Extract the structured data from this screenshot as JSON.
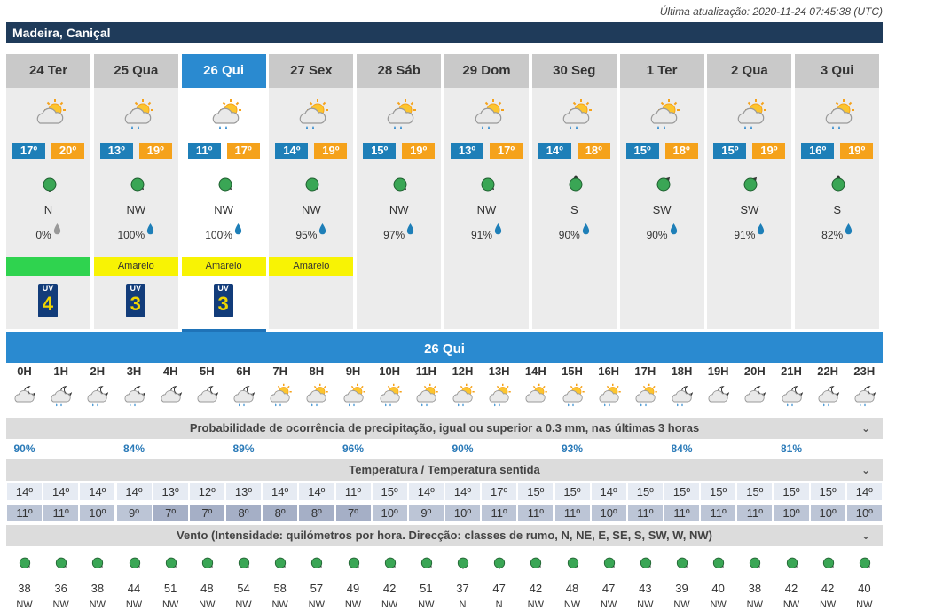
{
  "last_update": "Última atualização: 2020-11-24 07:45:38 (UTC)",
  "location": "Madeira, Caniçal",
  "colors": {
    "location_bar": "#1f3b5a",
    "selected_day": "#2a8ad0",
    "tmin": "#1e7fb8",
    "tmax": "#f5a21b",
    "warn_green": "#2fd34f",
    "warn_yellow": "#f8f304"
  },
  "days": [
    {
      "label": "24 Ter",
      "icon": "sun-cloud-icon",
      "tmin": "17º",
      "tmax": "20º",
      "wind_dir": "N",
      "precip": "0%",
      "drop": "grey",
      "warning": "",
      "warning_color": "green",
      "uv": "4"
    },
    {
      "label": "25 Qua",
      "icon": "sun-cloud-rain-icon",
      "tmin": "13º",
      "tmax": "19º",
      "wind_dir": "NW",
      "precip": "100%",
      "drop": "blue",
      "warning": "Amarelo",
      "warning_color": "yellow",
      "uv": "3"
    },
    {
      "label": "26 Qui",
      "icon": "sun-cloud-rain-icon",
      "tmin": "11º",
      "tmax": "17º",
      "wind_dir": "NW",
      "precip": "100%",
      "drop": "blue",
      "warning": "Amarelo",
      "warning_color": "yellow",
      "uv": "3",
      "selected": true
    },
    {
      "label": "27 Sex",
      "icon": "sun-cloud-rain-icon",
      "tmin": "14º",
      "tmax": "19º",
      "wind_dir": "NW",
      "precip": "95%",
      "drop": "blue",
      "warning": "Amarelo",
      "warning_color": "yellow",
      "uv": ""
    },
    {
      "label": "28 Sáb",
      "icon": "sun-cloud-rain-icon",
      "tmin": "15º",
      "tmax": "19º",
      "wind_dir": "NW",
      "precip": "97%",
      "drop": "blue",
      "warning": "",
      "warning_color": "",
      "uv": ""
    },
    {
      "label": "29 Dom",
      "icon": "sun-cloud-rain-icon",
      "tmin": "13º",
      "tmax": "17º",
      "wind_dir": "NW",
      "precip": "91%",
      "drop": "blue",
      "warning": "",
      "warning_color": "",
      "uv": ""
    },
    {
      "label": "30 Seg",
      "icon": "sun-cloud-rain-icon",
      "tmin": "14º",
      "tmax": "18º",
      "wind_dir": "S",
      "precip": "90%",
      "drop": "blue",
      "warning": "",
      "warning_color": "",
      "uv": ""
    },
    {
      "label": "1 Ter",
      "icon": "sun-cloud-rain-icon",
      "tmin": "15º",
      "tmax": "18º",
      "wind_dir": "SW",
      "precip": "90%",
      "drop": "blue",
      "warning": "",
      "warning_color": "",
      "uv": ""
    },
    {
      "label": "2 Qua",
      "icon": "sun-cloud-rain-icon",
      "tmin": "15º",
      "tmax": "19º",
      "wind_dir": "SW",
      "precip": "91%",
      "drop": "blue",
      "warning": "",
      "warning_color": "",
      "uv": ""
    },
    {
      "label": "3 Qui",
      "icon": "sun-cloud-rain-icon",
      "tmin": "16º",
      "tmax": "19º",
      "wind_dir": "S",
      "precip": "82%",
      "drop": "blue",
      "warning": "",
      "warning_color": "",
      "uv": ""
    }
  ],
  "selected_day_title": "26 Qui",
  "hours": [
    "0H",
    "1H",
    "2H",
    "3H",
    "4H",
    "5H",
    "6H",
    "7H",
    "8H",
    "9H",
    "10H",
    "11H",
    "12H",
    "13H",
    "14H",
    "15H",
    "16H",
    "17H",
    "18H",
    "19H",
    "20H",
    "21H",
    "22H",
    "23H"
  ],
  "hour_icons": [
    "moon-cloud-icon",
    "moon-cloud-rain-icon",
    "moon-cloud-rain-icon",
    "moon-cloud-rain-icon",
    "moon-cloud-icon",
    "moon-cloud-icon",
    "moon-cloud-rain-icon",
    "sun-cloud-rain-icon",
    "sun-cloud-rain-icon",
    "sun-cloud-rain-icon",
    "sun-cloud-rain-icon",
    "sun-cloud-rain-icon",
    "sun-cloud-rain-icon",
    "sun-cloud-rain-icon",
    "sun-cloud-icon",
    "sun-cloud-rain-icon",
    "sun-cloud-rain-icon",
    "sun-cloud-rain-icon",
    "moon-cloud-rain-icon",
    "moon-cloud-icon",
    "moon-cloud-icon",
    "moon-cloud-rain-icon",
    "moon-cloud-rain-icon",
    "moon-cloud-rain-icon"
  ],
  "precip_section": "Probabilidade de ocorrência de precipitação, igual ou superior a 0.3 mm, nas últimas 3 horas",
  "precip_values": [
    {
      "hour_index": 0,
      "value": "90%"
    },
    {
      "hour_index": 3,
      "value": "84%"
    },
    {
      "hour_index": 6,
      "value": "89%"
    },
    {
      "hour_index": 9,
      "value": "96%"
    },
    {
      "hour_index": 12,
      "value": "90%"
    },
    {
      "hour_index": 15,
      "value": "93%"
    },
    {
      "hour_index": 18,
      "value": "84%"
    },
    {
      "hour_index": 21,
      "value": "81%"
    }
  ],
  "temp_section": "Temperatura / Temperatura sentida",
  "temp": [
    "14º",
    "14º",
    "14º",
    "14º",
    "13º",
    "12º",
    "13º",
    "14º",
    "14º",
    "11º",
    "15º",
    "14º",
    "14º",
    "17º",
    "15º",
    "15º",
    "14º",
    "15º",
    "15º",
    "15º",
    "15º",
    "15º",
    "15º",
    "14º"
  ],
  "feels": [
    "11º",
    "11º",
    "10º",
    "9º",
    "7º",
    "7º",
    "8º",
    "8º",
    "8º",
    "7º",
    "10º",
    "9º",
    "10º",
    "11º",
    "11º",
    "11º",
    "10º",
    "11º",
    "11º",
    "11º",
    "11º",
    "10º",
    "10º",
    "10º"
  ],
  "feels_dark": [
    false,
    false,
    false,
    false,
    true,
    true,
    true,
    true,
    true,
    true,
    false,
    false,
    false,
    false,
    false,
    false,
    false,
    false,
    false,
    false,
    false,
    false,
    false,
    false
  ],
  "wind_section": "Vento (Intensidade: quilómetros por hora. Direcção: classes de rumo, N, NE, E, SE, S, SW, W, NW)",
  "wind_speed": [
    "38",
    "36",
    "38",
    "44",
    "51",
    "48",
    "54",
    "58",
    "57",
    "49",
    "42",
    "51",
    "37",
    "47",
    "42",
    "48",
    "47",
    "43",
    "39",
    "40",
    "38",
    "42",
    "42",
    "40"
  ],
  "wind_dirs": [
    "NW",
    "NW",
    "NW",
    "NW",
    "NW",
    "NW",
    "NW",
    "NW",
    "NW",
    "NW",
    "NW",
    "NW",
    "N",
    "N",
    "NW",
    "NW",
    "NW",
    "NW",
    "NW",
    "NW",
    "NW",
    "NW",
    "NW",
    "NW"
  ],
  "chevron": "⌄"
}
